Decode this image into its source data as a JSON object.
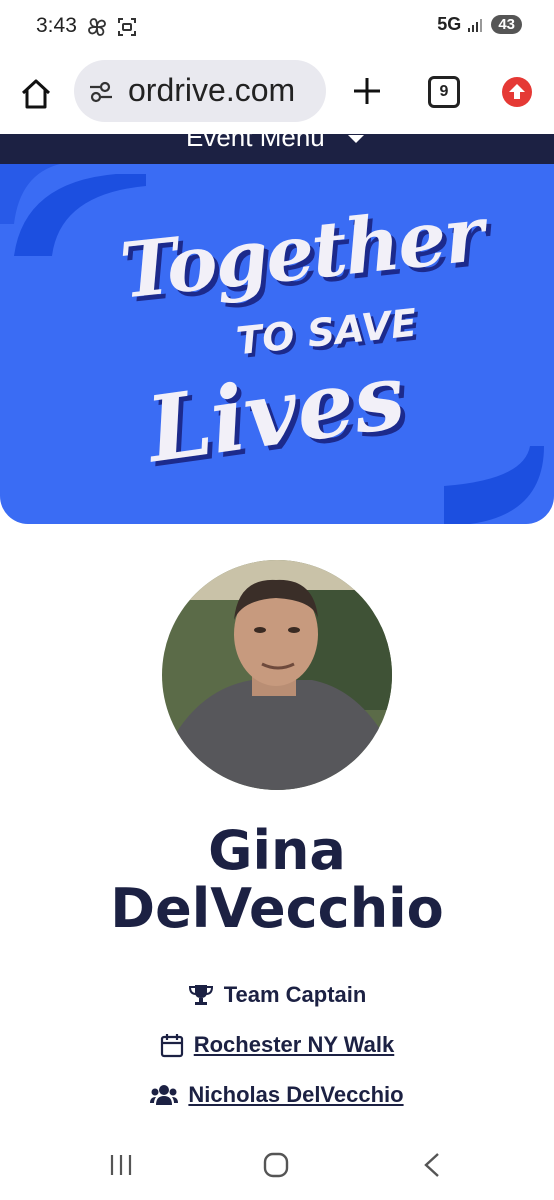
{
  "status": {
    "time": "3:43",
    "network": "5G",
    "battery": "43"
  },
  "browser": {
    "url": "ordrive.com",
    "tab_count": "9",
    "home_icon": "home-icon",
    "site_settings_icon": "tune-icon",
    "new_tab_icon": "plus-icon",
    "update_icon": "arrow-up-icon"
  },
  "page": {
    "event_menu_label": "Event Menu",
    "hero": {
      "line1": "Together",
      "line2": "TO SAVE",
      "line3": "Lives"
    },
    "participant": {
      "name_first": "Gina",
      "name_last": "DelVecchio",
      "role": "Team Captain",
      "event_link": "Rochester NY Walk",
      "team_link": "Nicholas DelVecchio"
    }
  },
  "colors": {
    "brand_navy": "#1c2143",
    "brand_blue": "#3a6cf4",
    "accent_blue": "#1c4fe0"
  }
}
